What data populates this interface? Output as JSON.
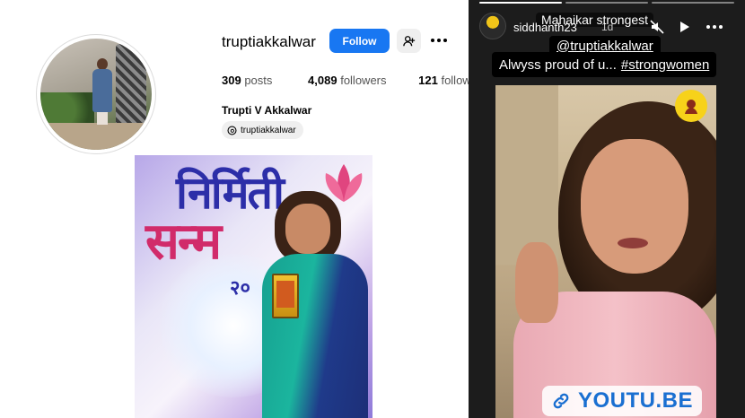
{
  "profile": {
    "username": "truptiakkalwar",
    "follow_label": "Follow",
    "stats": {
      "posts_count": "309",
      "posts_label": "posts",
      "followers_count": "4,089",
      "followers_label": "followers",
      "following_count": "121",
      "following_label": "following"
    },
    "full_name": "Trupti V Akkalwar",
    "threads_handle": "truptiakkalwar",
    "icons": {
      "suggest": "person-add-icon",
      "more": "more-horizontal-icon",
      "threads": "threads-icon"
    },
    "colors": {
      "follow_button": "#1877f2"
    }
  },
  "award_photo": {
    "banner_line1": "निर्मिती",
    "banner_line2": "सन्म",
    "banner_year": "२०"
  },
  "story": {
    "username": "siddhanth23",
    "time": "1d",
    "overlay_text": "Mahaikar strongest",
    "mention": "@truptiakkalwar",
    "caption": "Alwyss proud of u...",
    "hashtag": "#strongwomen",
    "link_sticker": "YOUTU.BE",
    "progress_segments": 3,
    "progress_done": 1,
    "icons": {
      "mute": "muted-speaker-icon",
      "play": "play-icon",
      "more": "more-horizontal-icon",
      "link": "link-icon"
    }
  }
}
